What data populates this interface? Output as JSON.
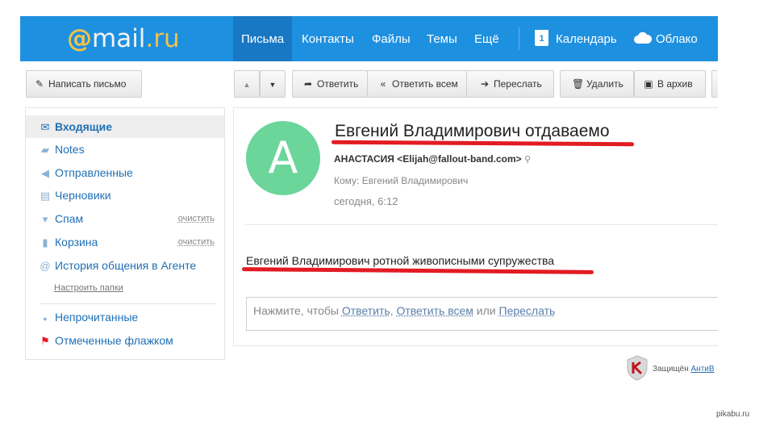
{
  "header": {
    "logo_at": "@",
    "logo_mail": "mail",
    "logo_tld": ".ru",
    "nav": [
      "Письма",
      "Контакты",
      "Файлы",
      "Темы",
      "Ещё"
    ],
    "calendar_day": "1",
    "calendar_label": "Календарь",
    "cloud_label": "Облако"
  },
  "toolbar": {
    "compose": "Написать письмо",
    "reply": "Ответить",
    "reply_all": "Ответить всем",
    "forward": "Переслать",
    "delete": "Удалить",
    "archive": "В архив"
  },
  "sidebar": {
    "folders": [
      {
        "label": "Входящие",
        "icon": "mail-icon",
        "clean": ""
      },
      {
        "label": "Notes",
        "icon": "folder-icon",
        "clean": ""
      },
      {
        "label": "Отправленные",
        "icon": "reply-icon",
        "clean": ""
      },
      {
        "label": "Черновики",
        "icon": "draft-icon",
        "clean": ""
      },
      {
        "label": "Спам",
        "icon": "thumb-down-icon",
        "clean": "очистить"
      },
      {
        "label": "Корзина",
        "icon": "trash-icon",
        "clean": "очистить"
      },
      {
        "label": "История общения в Агенте",
        "icon": "at-icon",
        "clean": ""
      }
    ],
    "setup_link": "Настроить папки",
    "filters": [
      {
        "label": "Непрочитанные",
        "icon": "dot-icon"
      },
      {
        "label": "Отмеченные флажком",
        "icon": "flag-icon"
      }
    ]
  },
  "message": {
    "avatar_letter": "А",
    "subject": "Евгений Владимирович отдаваемо",
    "from": "АНАСТАСИЯ <Elijah@fallout-band.com>",
    "to": "Кому: Евгений Владимирович",
    "date": "сегодня, 6:12",
    "body": "Евгений Владимирович ротной живописными супружества",
    "quick_reply_prefix": "Нажмите, чтобы",
    "quick_reply_reply": "Ответить",
    "quick_reply_reply_all": "Ответить всем",
    "quick_reply_or": "или",
    "quick_reply_forward": "Переслать"
  },
  "footer": {
    "protected_label": "Защищён",
    "antivirus": "АнтиВ"
  },
  "watermark": "pikabu.ru",
  "colors": {
    "topbar": "#1e90e0",
    "topbar_active": "#1978c4",
    "link": "#1f6fb4",
    "avatar": "#6cd59a",
    "underline": "#e21b23"
  }
}
